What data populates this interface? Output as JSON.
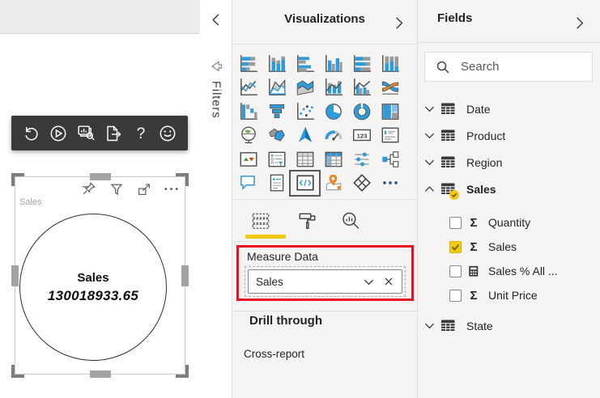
{
  "colors": {
    "accent": "#F2C811",
    "highlight_red": "#E81123",
    "toolbar_bg": "#3B3A39",
    "icon_blue": "#2F9BD8"
  },
  "canvas": {
    "toolbar_icons": [
      "refresh",
      "play",
      "view-records",
      "export-page",
      "help",
      "feedback-smiley"
    ],
    "visual_toolbar_icons": [
      "pin",
      "filter",
      "focus-mode",
      "more-options"
    ],
    "visual": {
      "title": "Sales",
      "card_label": "Sales",
      "card_value": "130018933.65"
    }
  },
  "filters_pane": {
    "title": "Filters",
    "icons": [
      "expand-left-chevron",
      "filters-funnel"
    ]
  },
  "visualizations": {
    "title": "Visualizations",
    "collapse_icon": "chevron-right",
    "selected": "script-visual",
    "gallery": [
      "stacked-bar-chart",
      "stacked-column-chart",
      "clustered-bar-chart",
      "clustered-column-chart",
      "hundred-stacked-bar-chart",
      "hundred-stacked-column-chart",
      "line-chart",
      "area-chart",
      "stacked-area-chart",
      "line-stacked-column-chart",
      "line-clustered-column-chart",
      "ribbon-chart",
      "waterfall-chart",
      "funnel-chart",
      "scatter-chart",
      "pie-chart",
      "donut-chart",
      "treemap",
      "map",
      "filled-map",
      "shape-map",
      "gauge",
      "card",
      "multi-row-card",
      "kpi",
      "slicer",
      "table",
      "matrix",
      "key-influencers",
      "decomposition-tree",
      "qa",
      "smart-narrative",
      "script-visual",
      "arcgis-map",
      "power-apps",
      "more-visuals"
    ],
    "tabs": [
      {
        "id": "fields-tab",
        "icon": "fields-tab-icon",
        "active": true
      },
      {
        "id": "format-tab",
        "icon": "paint-roller-icon",
        "active": false
      },
      {
        "id": "analytics-tab",
        "icon": "analytics-magnifier-icon",
        "active": false
      }
    ],
    "field_well": {
      "label": "Measure Data",
      "value": "Sales",
      "icons": [
        "chevron-down",
        "remove-x"
      ]
    },
    "drill_through": {
      "title": "Drill through",
      "cross_report": "Cross-report"
    }
  },
  "fields_pane": {
    "title": "Fields",
    "collapse_icon": "chevron-right",
    "search_placeholder": "Search",
    "tables": [
      {
        "name": "Date",
        "expanded": false
      },
      {
        "name": "Product",
        "expanded": false
      },
      {
        "name": "Region",
        "expanded": false
      },
      {
        "name": "Sales",
        "expanded": true,
        "selected": true,
        "fields": [
          {
            "name": "Quantity",
            "type": "measure",
            "checked": false
          },
          {
            "name": "Sales",
            "type": "measure",
            "checked": true
          },
          {
            "name": "Sales % All ...",
            "type": "calculated",
            "checked": false
          },
          {
            "name": "Unit Price",
            "type": "measure",
            "checked": false
          }
        ]
      },
      {
        "name": "State",
        "expanded": false
      }
    ]
  }
}
